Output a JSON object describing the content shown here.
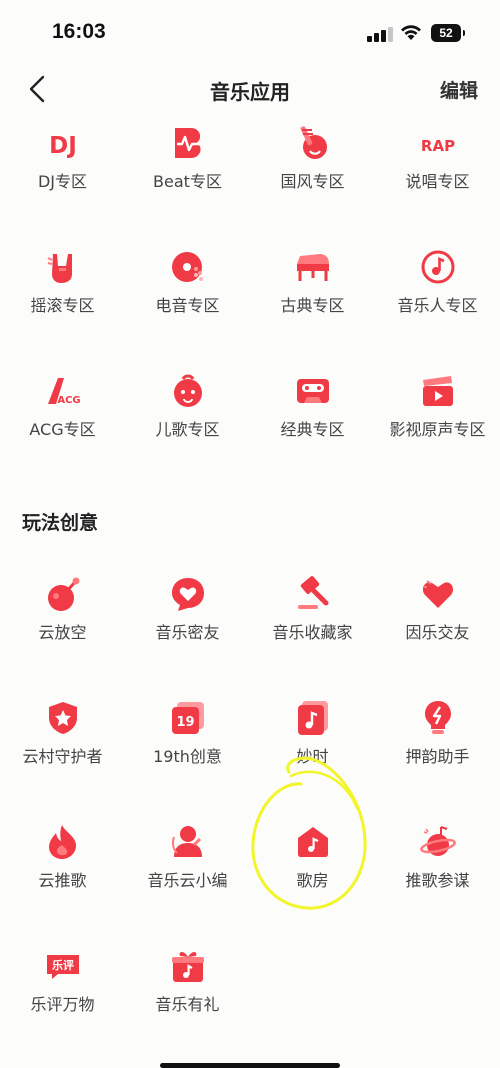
{
  "status_bar": {
    "time": "16:03",
    "battery": "52"
  },
  "nav": {
    "title": "音乐应用",
    "edit_label": "编辑"
  },
  "apps": [
    {
      "label": "DJ专区",
      "icon": "dj-icon"
    },
    {
      "label": "Beat专区",
      "icon": "beat-icon"
    },
    {
      "label": "国风专区",
      "icon": "guofeng-icon"
    },
    {
      "label": "说唱专区",
      "icon": "rap-icon"
    },
    {
      "label": "摇滚专区",
      "icon": "rock-hand-icon"
    },
    {
      "label": "电音专区",
      "icon": "electronic-disc-icon"
    },
    {
      "label": "古典专区",
      "icon": "piano-icon"
    },
    {
      "label": "音乐人专区",
      "icon": "musician-note-icon"
    },
    {
      "label": "ACG专区",
      "icon": "acg-icon"
    },
    {
      "label": "儿歌专区",
      "icon": "kid-face-icon"
    },
    {
      "label": "经典专区",
      "icon": "cassette-icon"
    },
    {
      "label": "影视原声专区",
      "icon": "clapperboard-icon"
    }
  ],
  "section_title": "玩法创意",
  "creative": [
    {
      "label": "云放空",
      "icon": "cloud-relax-icon"
    },
    {
      "label": "音乐密友",
      "icon": "chat-heart-icon"
    },
    {
      "label": "音乐收藏家",
      "icon": "gavel-icon"
    },
    {
      "label": "因乐交友",
      "icon": "friends-heart-icon"
    },
    {
      "label": "云村守护者",
      "icon": "shield-star-icon"
    },
    {
      "label": "19th创意",
      "icon": "19th-icon"
    },
    {
      "label": "妙时",
      "icon": "music-card-icon"
    },
    {
      "label": "押韵助手",
      "icon": "bulb-icon"
    },
    {
      "label": "云推歌",
      "icon": "flame-icon"
    },
    {
      "label": "音乐云小编",
      "icon": "editor-person-icon"
    },
    {
      "label": "歌房",
      "icon": "song-room-icon"
    },
    {
      "label": "推歌参谋",
      "icon": "planet-note-icon"
    },
    {
      "label": "乐评万物",
      "icon": "comment-tag-icon"
    },
    {
      "label": "音乐有礼",
      "icon": "gift-icon"
    }
  ],
  "icon_labels": {
    "dj": "DJ",
    "rap": "RAP",
    "acg": "ACG",
    "nineteen": "19",
    "comment": "乐评"
  },
  "colors": {
    "accent": "#f03a46",
    "accent_light": "#ff7a7f",
    "annotation": "#f2f52a"
  }
}
